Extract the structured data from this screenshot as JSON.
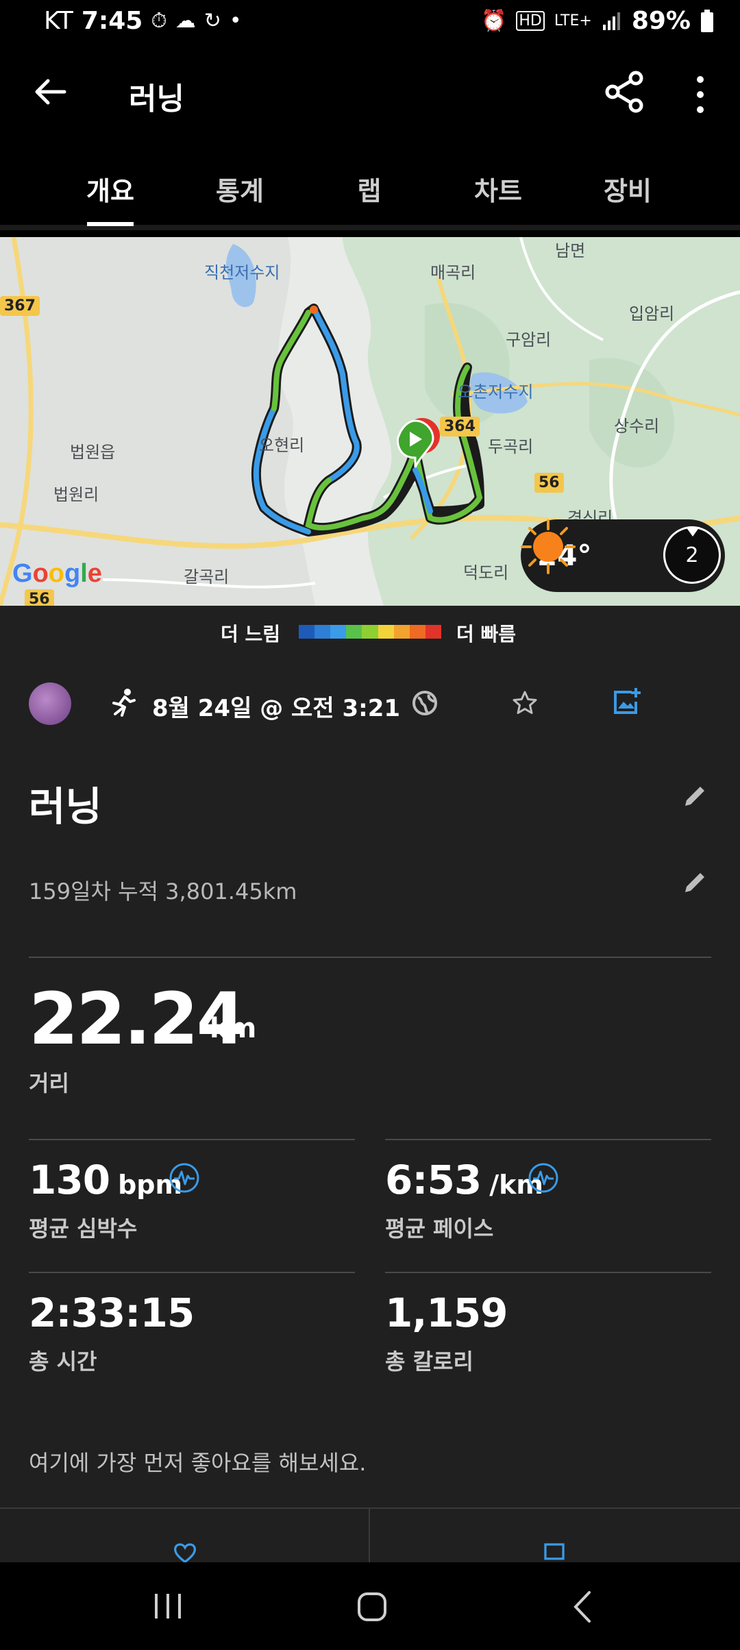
{
  "status_bar": {
    "carrier": "KT",
    "time": "7:45",
    "network": "LTE+",
    "battery": "89%"
  },
  "app_bar": {
    "title": "러닝"
  },
  "tabs": [
    {
      "label": "개요",
      "active": true
    },
    {
      "label": "통계",
      "active": false
    },
    {
      "label": "랩",
      "active": false
    },
    {
      "label": "차트",
      "active": false
    },
    {
      "label": "장비",
      "active": false
    }
  ],
  "map": {
    "labels": [
      "직천저수지",
      "매곡리",
      "남면",
      "입암리",
      "구암리",
      "오촌저수지",
      "법원읍",
      "오현리",
      "두곡리",
      "상수리",
      "법원리",
      "갈곡리",
      "덕도리",
      "경신리"
    ],
    "road_numbers": [
      "367",
      "364",
      "56",
      "56"
    ],
    "provider": "Google",
    "weather": {
      "temperature": "24°",
      "wind": "2",
      "icon": "sun-icon"
    }
  },
  "speed_legend": {
    "slow": "더 느림",
    "fast": "더 빠름",
    "colors": [
      "#1e5bb8",
      "#2e7fd6",
      "#3a9be8",
      "#58c24a",
      "#8fcf32",
      "#f2d43a",
      "#f3a22e",
      "#ef6a22",
      "#e2332a"
    ]
  },
  "activity": {
    "date": "8월 24일 @ 오전 3:21",
    "title": "러닝",
    "description": "159일차 누적 3,801.45km",
    "distance": {
      "value": "22.24",
      "unit": "km",
      "label": "거리"
    },
    "stats": [
      {
        "value": "130",
        "unit": "bpm",
        "label": "평균 심박수",
        "has_chart_icon": true
      },
      {
        "value": "6:53",
        "unit": "/km",
        "label": "평균 페이스",
        "has_chart_icon": true
      },
      {
        "value": "2:33:15",
        "unit": "",
        "label": "총 시간",
        "has_chart_icon": false
      },
      {
        "value": "1,159",
        "unit": "",
        "label": "총 칼로리",
        "has_chart_icon": false
      }
    ],
    "like_prompt": "여기에 가장 먼저 좋아요를 해보세요."
  },
  "accent_color": "#3a9be8"
}
